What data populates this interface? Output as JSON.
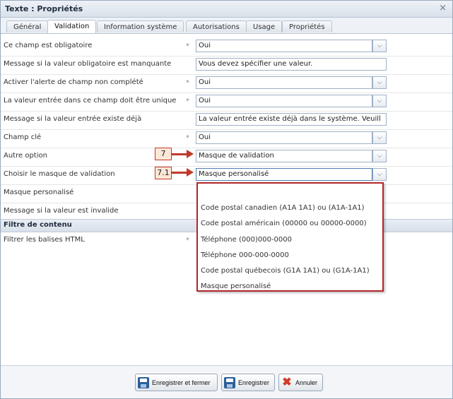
{
  "window": {
    "title": "Texte : Propriétés",
    "close_glyph": "×"
  },
  "tabs": [
    {
      "label": "Général"
    },
    {
      "label": "Validation"
    },
    {
      "label": "Information système"
    },
    {
      "label": "Autorisations"
    },
    {
      "label": "Usage"
    },
    {
      "label": "Propriétés"
    }
  ],
  "active_tab": "Validation",
  "fields": [
    {
      "label": "Ce champ est obligatoire",
      "required": "*",
      "value": "Oui",
      "type": "select"
    },
    {
      "label": "Message si la valeur obligatoire est manquante",
      "required": "",
      "value": "Vous devez spécifier une valeur.",
      "type": "text"
    },
    {
      "label": "Activer l'alerte de champ non complété",
      "required": "*",
      "value": "Oui",
      "type": "select"
    },
    {
      "label": "La valeur entrée dans ce champ doit être unique",
      "required": "*",
      "value": "Oui",
      "type": "select"
    },
    {
      "label": "Message si la valeur entrée existe déjà",
      "required": "",
      "value": "La valeur entrée existe déjà  dans le système. Veuill",
      "type": "text"
    },
    {
      "label": "Champ clé",
      "required": "*",
      "value": "Oui",
      "type": "select"
    },
    {
      "label": "Autre option",
      "required": "",
      "value": "Masque de validation",
      "type": "select"
    },
    {
      "label": "Choisir le masque de validation",
      "required": "",
      "value": "Masque personalisé",
      "type": "select"
    },
    {
      "label": "Masque personalisé",
      "required": "",
      "value": "",
      "type": "none"
    },
    {
      "label": "Message si la valeur est invalide",
      "required": "",
      "value": "",
      "type": "none"
    }
  ],
  "section": {
    "title": "Filtre de contenu"
  },
  "filter_field": {
    "label": "Filtrer les balises HTML",
    "required": "*"
  },
  "dropdown": {
    "options": [
      "Code postal canadien (A1A 1A1) ou (A1A-1A1)",
      "Code postal américain (00000 ou 00000-0000)",
      "Téléphone (000)000-0000",
      "Téléphone 000-000-0000",
      "Code postal québecois (G1A 1A1) ou (G1A-1A1)",
      "Masque personalisé"
    ]
  },
  "callouts": [
    {
      "label": "7"
    },
    {
      "label": "7.1"
    }
  ],
  "buttons": {
    "save_close": "Enregistrer et fermer",
    "save": "Enregistrer",
    "cancel": "Annuler"
  },
  "icons": {
    "dropdown_trigger": "chevron-down-icon",
    "save": "floppy-disk-icon",
    "cancel": "red-x-icon"
  },
  "colors": {
    "callout_border": "#c0392b",
    "dropdown_border": "#b0262a",
    "header_bg": "#d9e1ea"
  }
}
